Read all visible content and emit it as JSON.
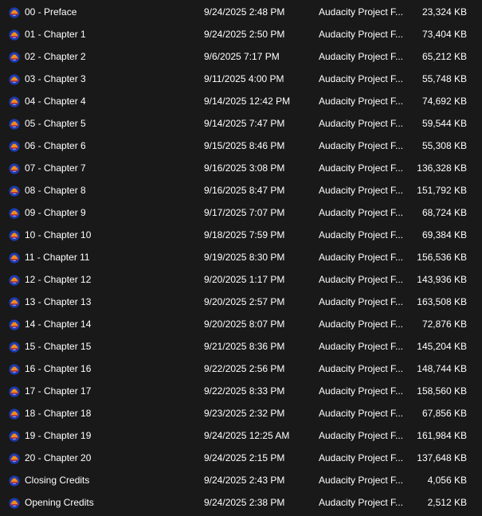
{
  "files": [
    {
      "name": "00 - Preface",
      "date": "9/24/2025 2:48 PM",
      "type": "Audacity Project F...",
      "size": "23,324 KB",
      "icon": "audacity-icon"
    },
    {
      "name": "01 - Chapter 1",
      "date": "9/24/2025 2:50 PM",
      "type": "Audacity Project F...",
      "size": "73,404 KB",
      "icon": "audacity-icon"
    },
    {
      "name": "02 - Chapter 2",
      "date": "9/6/2025 7:17 PM",
      "type": "Audacity Project F...",
      "size": "65,212 KB",
      "icon": "audacity-icon"
    },
    {
      "name": "03 - Chapter 3",
      "date": "9/11/2025 4:00 PM",
      "type": "Audacity Project F...",
      "size": "55,748 KB",
      "icon": "audacity-icon"
    },
    {
      "name": "04 - Chapter 4",
      "date": "9/14/2025 12:42 PM",
      "type": "Audacity Project F...",
      "size": "74,692 KB",
      "icon": "audacity-icon"
    },
    {
      "name": "05 - Chapter 5",
      "date": "9/14/2025 7:47 PM",
      "type": "Audacity Project F...",
      "size": "59,544 KB",
      "icon": "audacity-icon"
    },
    {
      "name": "06 - Chapter 6",
      "date": "9/15/2025 8:46 PM",
      "type": "Audacity Project F...",
      "size": "55,308 KB",
      "icon": "audacity-icon"
    },
    {
      "name": "07 - Chapter 7",
      "date": "9/16/2025 3:08 PM",
      "type": "Audacity Project F...",
      "size": "136,328 KB",
      "icon": "audacity-icon"
    },
    {
      "name": "08 - Chapter 8",
      "date": "9/16/2025 8:47 PM",
      "type": "Audacity Project F...",
      "size": "151,792 KB",
      "icon": "audacity-icon"
    },
    {
      "name": "09 - Chapter 9",
      "date": "9/17/2025 7:07 PM",
      "type": "Audacity Project F...",
      "size": "68,724 KB",
      "icon": "audacity-icon"
    },
    {
      "name": "10 - Chapter 10",
      "date": "9/18/2025 7:59 PM",
      "type": "Audacity Project F...",
      "size": "69,384 KB",
      "icon": "audacity-icon"
    },
    {
      "name": "11 - Chapter 11",
      "date": "9/19/2025 8:30 PM",
      "type": "Audacity Project F...",
      "size": "156,536 KB",
      "icon": "audacity-icon"
    },
    {
      "name": "12 - Chapter 12",
      "date": "9/20/2025 1:17 PM",
      "type": "Audacity Project F...",
      "size": "143,936 KB",
      "icon": "audacity-icon"
    },
    {
      "name": "13 - Chapter 13",
      "date": "9/20/2025 2:57 PM",
      "type": "Audacity Project F...",
      "size": "163,508 KB",
      "icon": "audacity-icon"
    },
    {
      "name": "14 - Chapter 14",
      "date": "9/20/2025 8:07 PM",
      "type": "Audacity Project F...",
      "size": "72,876 KB",
      "icon": "audacity-icon"
    },
    {
      "name": "15 - Chapter 15",
      "date": "9/21/2025 8:36 PM",
      "type": "Audacity Project F...",
      "size": "145,204 KB",
      "icon": "audacity-icon"
    },
    {
      "name": "16 - Chapter 16",
      "date": "9/22/2025 2:56 PM",
      "type": "Audacity Project F...",
      "size": "148,744 KB",
      "icon": "audacity-icon"
    },
    {
      "name": "17 - Chapter 17",
      "date": "9/22/2025 8:33 PM",
      "type": "Audacity Project F...",
      "size": "158,560 KB",
      "icon": "audacity-icon"
    },
    {
      "name": "18 - Chapter 18",
      "date": "9/23/2025 2:32 PM",
      "type": "Audacity Project F...",
      "size": "67,856 KB",
      "icon": "audacity-icon"
    },
    {
      "name": "19 - Chapter 19",
      "date": "9/24/2025 12:25 AM",
      "type": "Audacity Project F...",
      "size": "161,984 KB",
      "icon": "audacity-icon"
    },
    {
      "name": "20 - Chapter 20",
      "date": "9/24/2025 2:15 PM",
      "type": "Audacity Project F...",
      "size": "137,648 KB",
      "icon": "audacity-icon"
    },
    {
      "name": "Closing Credits",
      "date": "9/24/2025 2:43 PM",
      "type": "Audacity Project F...",
      "size": "4,056 KB",
      "icon": "audacity-icon"
    },
    {
      "name": "Opening Credits",
      "date": "9/24/2025 2:38 PM",
      "type": "Audacity Project F...",
      "size": "2,512 KB",
      "icon": "audacity-icon"
    }
  ],
  "colors": {
    "background": "#191919",
    "text": "#ffffff",
    "icon_blue": "#1d3bb0",
    "icon_orange": "#f08a1c",
    "icon_red": "#d8281e"
  }
}
